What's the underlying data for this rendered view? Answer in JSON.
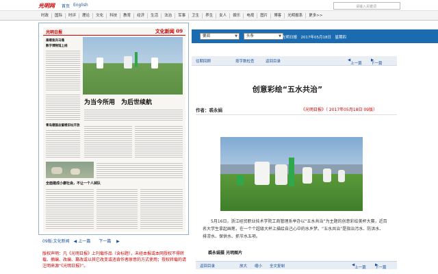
{
  "topbar": {
    "logo": "光明网",
    "links": [
      "首页",
      "English"
    ],
    "search_placeholder": "请输入关键词"
  },
  "nav": {
    "items": [
      "时政",
      "国际",
      "时评",
      "理论",
      "文化",
      "科技",
      "教育",
      "经济",
      "生活",
      "法治",
      "军事",
      "卫生",
      "养生",
      "女人",
      "娱乐",
      "电视",
      "图片",
      "博客",
      "光明报系",
      "更多>>"
    ]
  },
  "paper": {
    "logo": "光明日报",
    "section": "文化新闻 09",
    "headline_main": "为当今所用　为后世续航",
    "headline_left1": "泰顺垒兵马俑",
    "headline_left1b": "数字博物馆上线",
    "headline_left2": "青岛德国总督楼旧址开放",
    "headline_left3": "全面建成小康社会，不让一个人掉队"
  },
  "pagebar": {
    "page": "09版:文化新闻",
    "prev": "上一篇",
    "next": "下一篇"
  },
  "disclaimer": "版权声明：凡《光明日报》上刊载作品（含标题），未经本报或本网授权不得转载、摘编、改编、篡改或以其它改变或违背作者原意的方式使用；授权转载的请注明来源“《光明日报》”。",
  "selector": {
    "section": "要闻",
    "issue": "头条",
    "date": "光明日报　2017年05月18日　星期四"
  },
  "toolbar": {
    "prev_issue": "往期回顾",
    "browse": "按字数检查",
    "back": "返回目录",
    "prev": "上一篇",
    "next": "下一篇"
  },
  "article": {
    "title": "创意彩绘“五水共治”",
    "author": "作者：裘永娟",
    "source": "《光明日报》（ 2017年05月18日  09版）",
    "body": "5月16日，浙江经贸职业技术学院工商管理系举办以“五水共治”为主题的创意彩绘美杯大赛，近百名大学生拿起画笔，在一个个超级大杯上描绘自己心中的水乡梦。“五水共治”是指治污水、防洪水、排涝水、保供水、抓节水五项。",
    "credit": "裘永娟摄  光明图片"
  },
  "bottombar": {
    "back": "返回目录",
    "zoom_in": "放大",
    "zoom_out": "缩小",
    "all_text": "全文复制",
    "prev": "上一篇",
    "next": "下一篇"
  }
}
